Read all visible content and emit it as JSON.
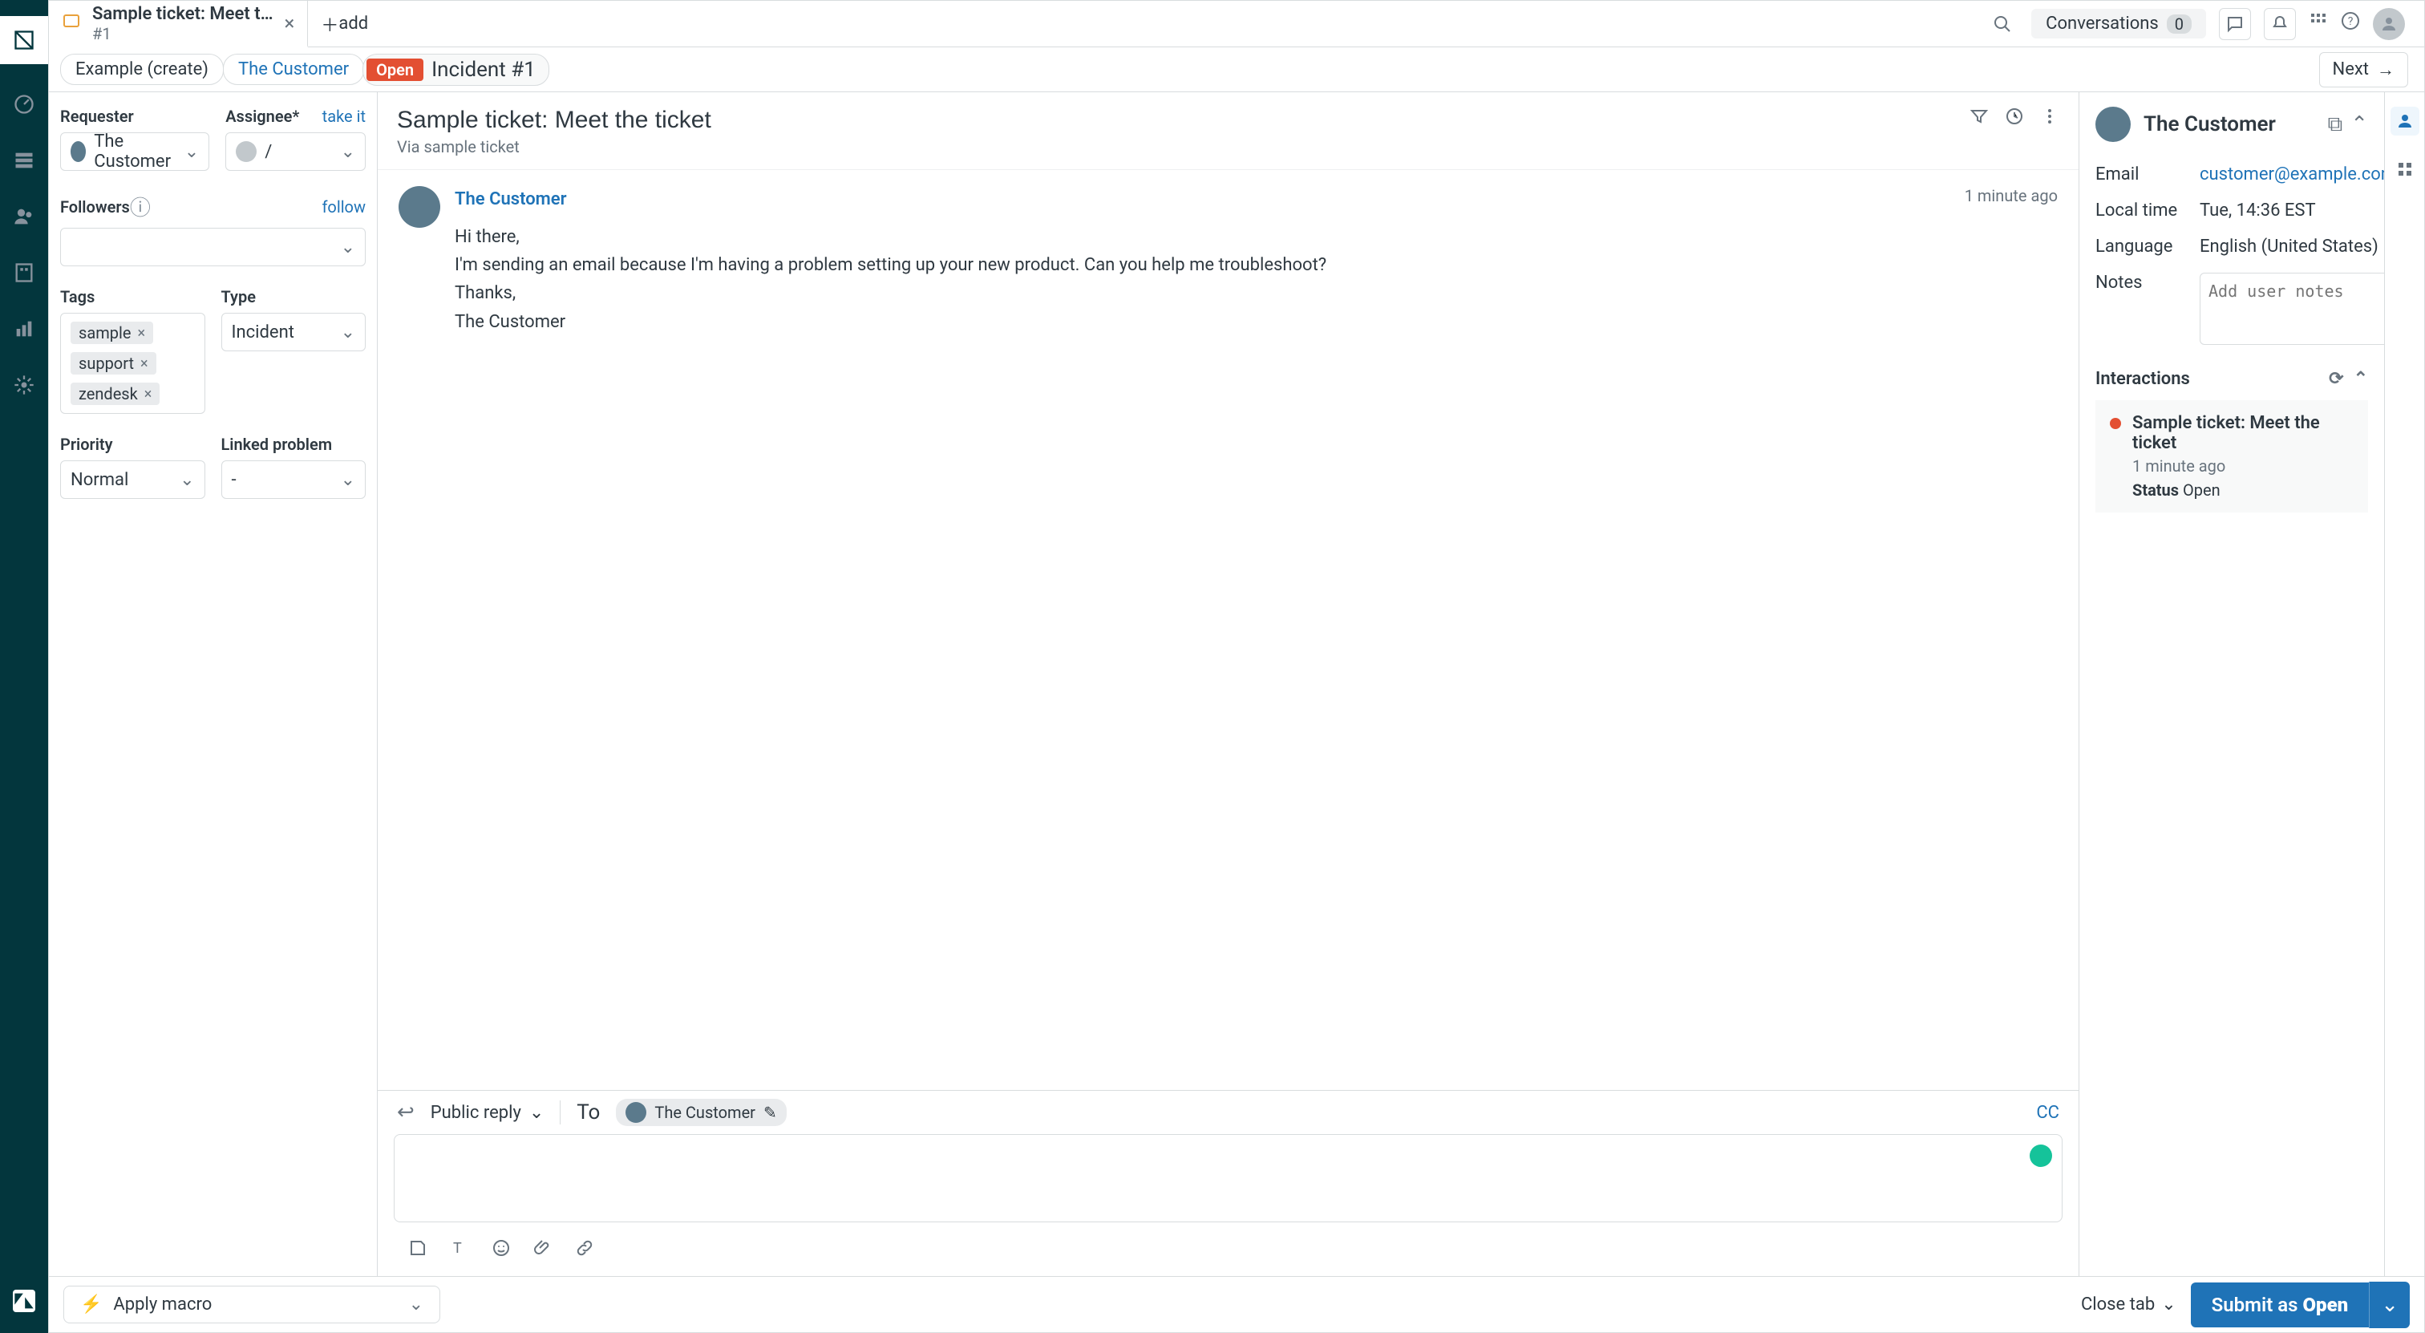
{
  "tab": {
    "title": "Sample ticket: Meet t…",
    "sub": "#1",
    "add_label": "add"
  },
  "topbar": {
    "conversations": "Conversations",
    "conv_count": "0"
  },
  "breadcrumb": {
    "example": "Example (create)",
    "customer": "The Customer"
  },
  "status": {
    "open": "Open",
    "incident": "Incident #1"
  },
  "next_label": "Next",
  "form": {
    "requester_label": "Requester",
    "requester_value": "The Customer",
    "assignee_label": "Assignee*",
    "take_it": "take it",
    "assignee_value": "/",
    "followers_label": "Followers",
    "follow": "follow",
    "tags_label": "Tags",
    "tags": [
      "sample",
      "support",
      "zendesk"
    ],
    "type_label": "Type",
    "type_value": "Incident",
    "priority_label": "Priority",
    "priority_value": "Normal",
    "linked_label": "Linked problem",
    "linked_value": "-"
  },
  "convo": {
    "subject": "Sample ticket: Meet the ticket",
    "via": "Via sample ticket",
    "from": "The Customer",
    "timestamp": "1 minute ago",
    "body": "Hi there,\nI'm sending an email because I'm having a problem setting up your new product. Can you help me troubleshoot?\nThanks,\nThe Customer"
  },
  "reply": {
    "type": "Public reply",
    "to_label": "To",
    "to_name": "The Customer",
    "cc": "CC"
  },
  "info": {
    "name": "The Customer",
    "email_label": "Email",
    "email": "customer@example.com",
    "localtime_label": "Local time",
    "localtime": "Tue, 14:36 EST",
    "language_label": "Language",
    "language": "English (United States)",
    "notes_label": "Notes",
    "notes_placeholder": "Add user notes"
  },
  "interactions": {
    "header": "Interactions",
    "item_title": "Sample ticket: Meet the ticket",
    "item_time": "1 minute ago",
    "status_label": "Status",
    "status_value": "Open"
  },
  "footer": {
    "macro": "Apply macro",
    "close_tab": "Close tab",
    "submit_prefix": "Submit as ",
    "submit_state": "Open"
  }
}
